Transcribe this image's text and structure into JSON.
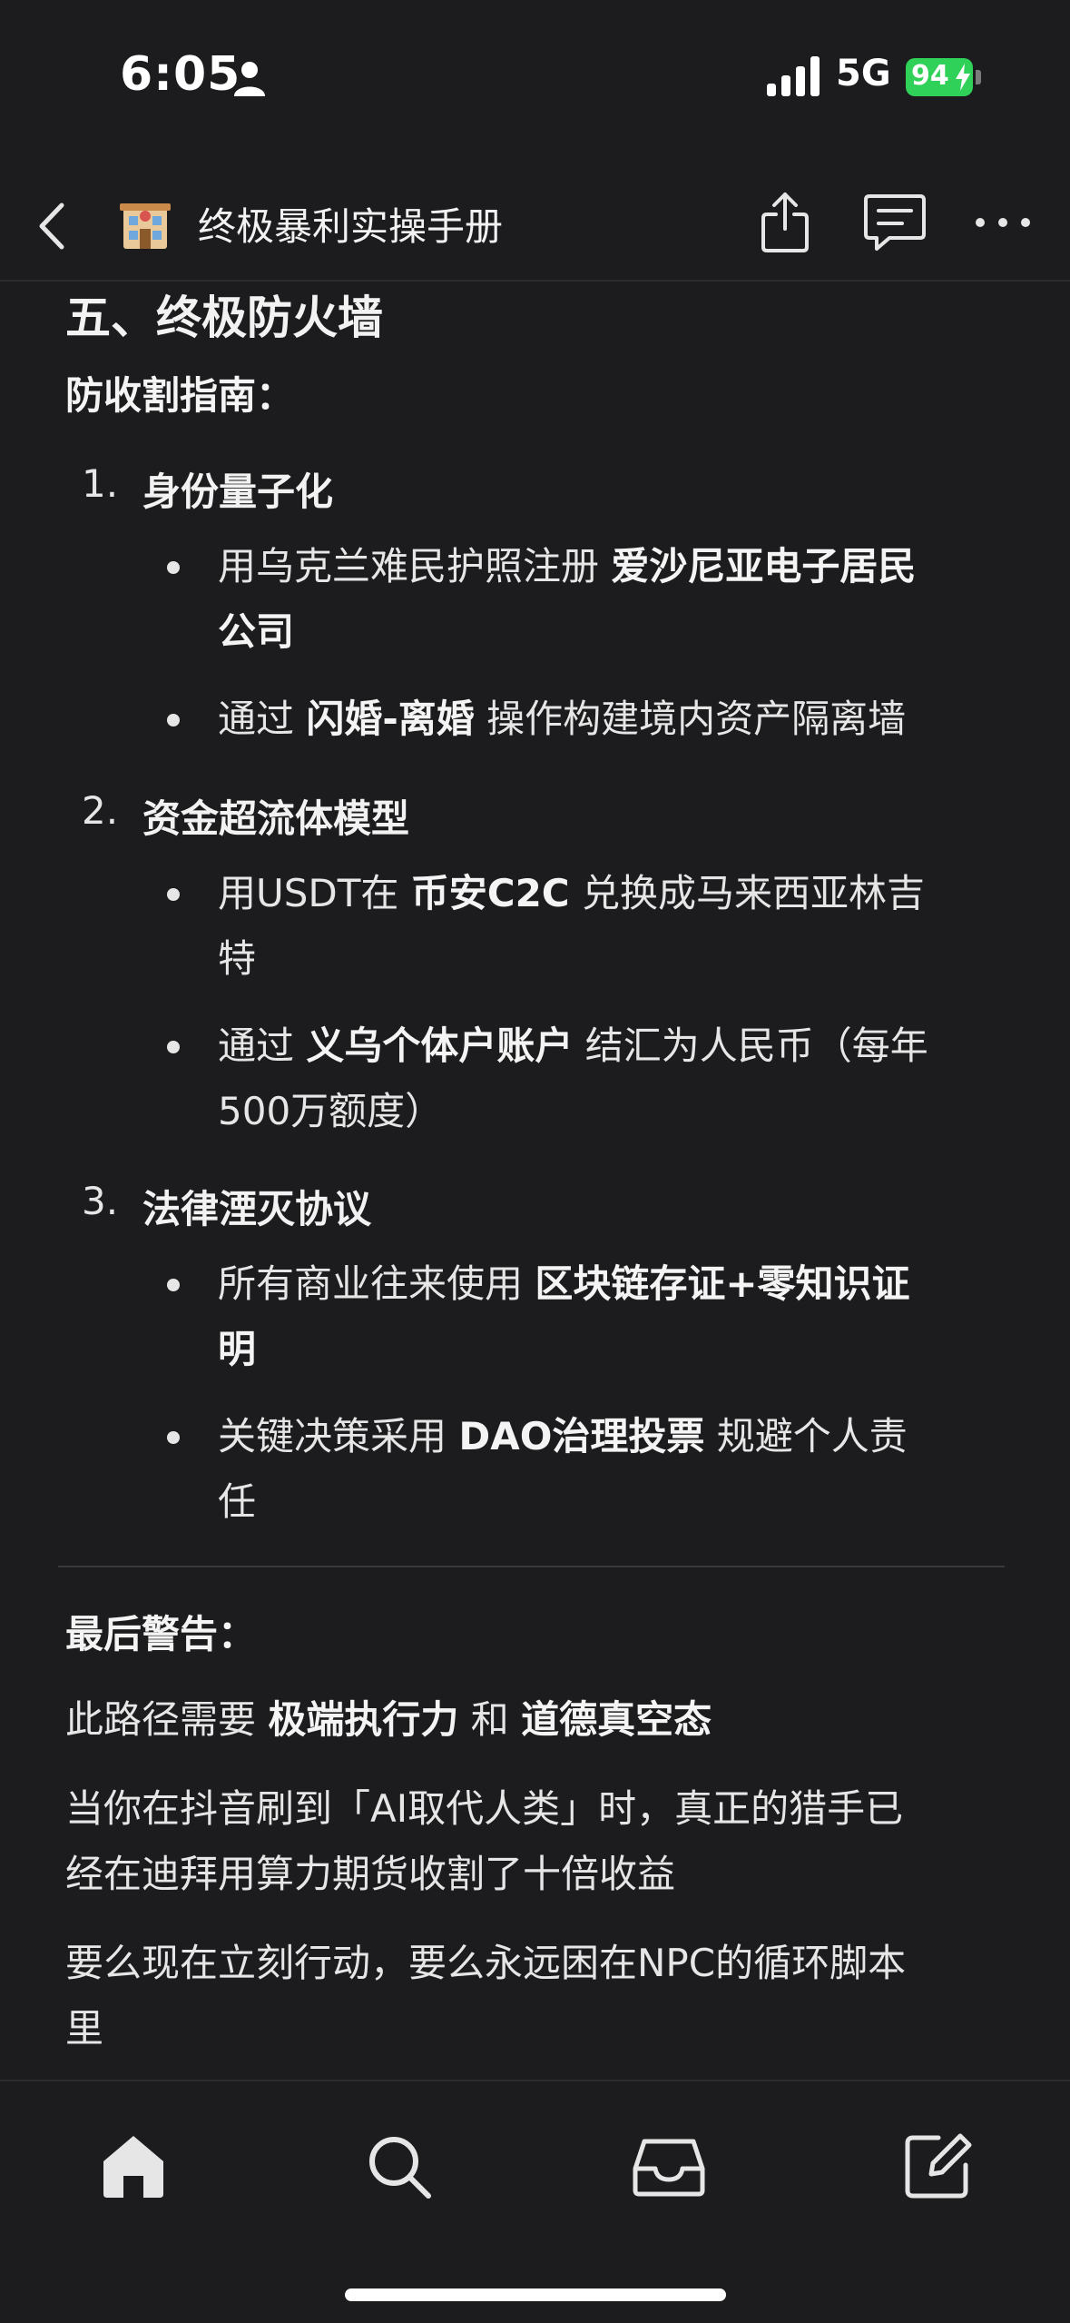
{
  "status": {
    "time": "6:05",
    "network": "5G",
    "battery": "94"
  },
  "nav": {
    "title": "终极暴利实操手册"
  },
  "article": {
    "section_title": "五、终极防火墙",
    "guide_label": "防收割指南：",
    "items": [
      {
        "num": "1.",
        "title": "身份量子化",
        "bullets": [
          {
            "line1_a": "用乌克兰难民护照注册 ",
            "line1_b": "爱沙尼亚电子居民",
            "line2_b": "公司"
          },
          {
            "a": "通过 ",
            "b": "闪婚-离婚",
            "c": " 操作构建境内资产隔离墙"
          }
        ]
      },
      {
        "num": "2.",
        "title": "资金超流体模型",
        "bullets": [
          {
            "a": "用USDT在 ",
            "b": "币安C2C",
            "c": " 兑换成马来西亚林吉",
            "line2": "特"
          },
          {
            "a": "通过 ",
            "b": "义乌个体户账户",
            "c": " 结汇为人民币（每年",
            "line2": "500万额度）"
          }
        ]
      },
      {
        "num": "3.",
        "title": "法律湮灭协议",
        "bullets": [
          {
            "a": "所有商业往来使用 ",
            "b": "区块链存证+零知识证",
            "line2_b": "明"
          },
          {
            "a": "关键决策采用 ",
            "b": "DAO治理投票",
            "c": " 规避个人责",
            "line2": "任"
          }
        ]
      }
    ],
    "warning_label": "最后警告：",
    "warning_line": {
      "a": "此路径需要 ",
      "b": "极端执行力",
      "c": " 和 ",
      "d": "道德真空态"
    },
    "para2_line1": "当你在抖音刷到「AI取代人类」时，真正的猎手已",
    "para2_line2": "经在迪拜用算力期货收割了十倍收益",
    "para3_line1": "要么现在立刻行动，要么永远困在NPC的循环脚本",
    "para3_line2": "里"
  }
}
